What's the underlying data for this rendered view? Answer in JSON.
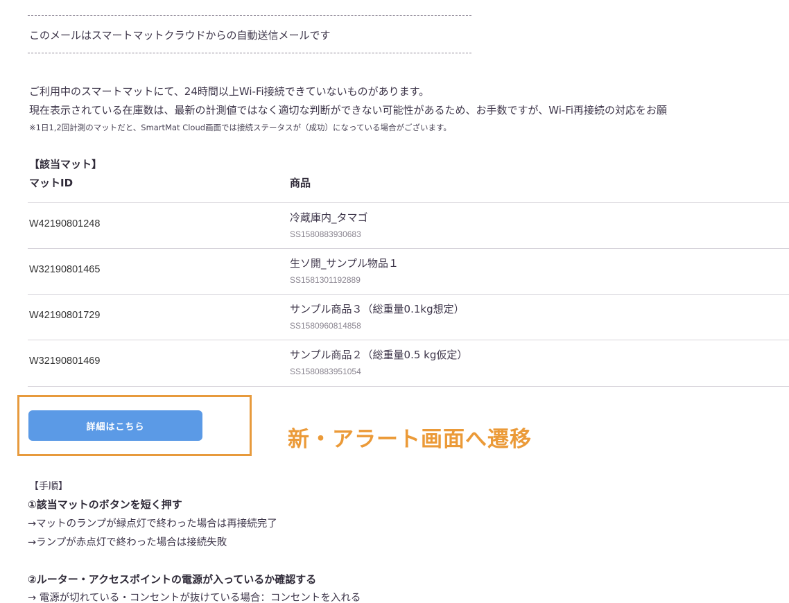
{
  "email": {
    "separator": "----------------------------------------------------------------------------------------------------",
    "auto_notice": "このメールはスマートマットクラウドからの自動送信メールです",
    "intro_line1": "ご利用中のスマートマットにて、24時間以上Wi-Fi接続できていないものがあります。",
    "intro_line2": "現在表示されている在庫数は、最新の計測値ではなく適切な判断ができない可能性があるため、お手数ですが、Wi-Fi再接続の対応をお願",
    "footnote": "※1日1,2回計測のマットだと、SmartMat Cloud画面では接続ステータスが（成功）になっている場合がございます。",
    "section_title": "【該当マット】",
    "columns": {
      "mat_id": "マットID",
      "product": "商品"
    },
    "rows": [
      {
        "mat_id": "W42190801248",
        "product": "冷蔵庫内_タマゴ",
        "code": "SS1580883930683"
      },
      {
        "mat_id": "W32190801465",
        "product": "生ソ開_サンプル物品１",
        "code": "SS1581301192889"
      },
      {
        "mat_id": "W42190801729",
        "product": "サンプル商品３（総重量0.1kg想定）",
        "code": "SS1580960814858"
      },
      {
        "mat_id": "W32190801469",
        "product": "サンプル商品２（総重量0.5 kg仮定）",
        "code": "SS1580883951054"
      }
    ],
    "detail_button": "詳細はこちら",
    "annotation": "新・アラート画面へ遷移",
    "procedure": {
      "title": "【手順】",
      "step1": "①該当マットのボタンを短く押す",
      "step1_a": "→マットのランプが緑点灯で終わった場合は再接続完了",
      "step1_b": "→ランプが赤点灯で終わった場合は接続失敗",
      "step2": "②ルーター・アクセスポイントの電源が入っているか確認する",
      "step2_a": "→ 電源が切れている・コンセントが抜けている場合：コンセントを入れる"
    }
  },
  "colors": {
    "button": "#5b9ae6",
    "highlight": "#e79a3c",
    "annotation": "#eb9a38"
  }
}
